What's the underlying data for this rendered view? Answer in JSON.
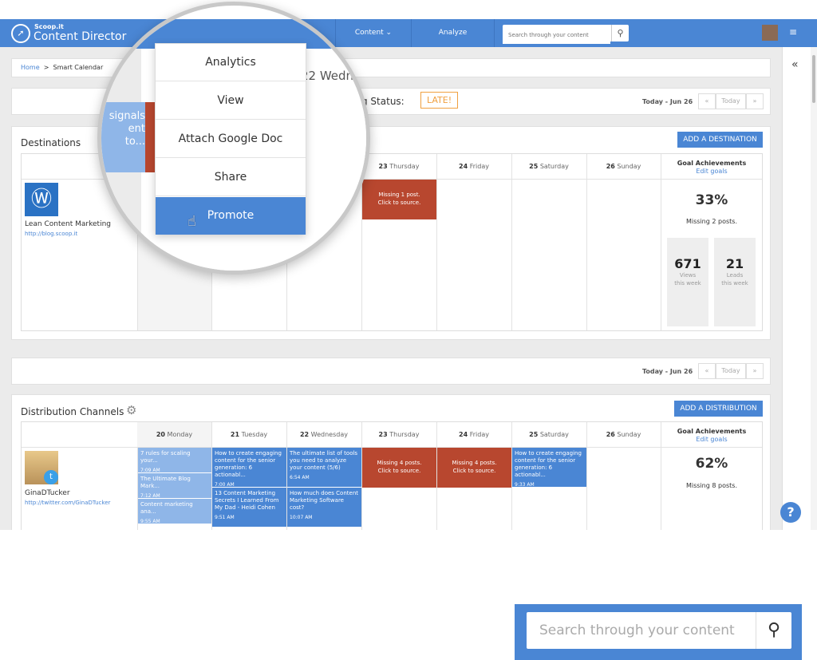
{
  "app": {
    "logo_small": "Scoop.it",
    "logo_title": "Content Director"
  },
  "nav": {
    "content": "Content",
    "analyze": "Analyze",
    "search_placeholder": "Search through your content"
  },
  "breadcrumb": {
    "home": "Home",
    "sep": ">",
    "current": "Smart Calendar"
  },
  "status": {
    "label": "g Status:",
    "value": "LATE!",
    "date_partial": "22 Wedn"
  },
  "pager": {
    "today_label": "Today - Jun 26",
    "prev": "«",
    "today": "Today",
    "next": "»"
  },
  "destinations": {
    "title": "Destinations",
    "add_button": "ADD A DESTINATION",
    "days": [
      {
        "num": "23",
        "name": "Thursday"
      },
      {
        "num": "24",
        "name": "Friday"
      },
      {
        "num": "25",
        "name": "Saturday"
      },
      {
        "num": "26",
        "name": "Sunday"
      }
    ],
    "goal_title": "Goal Achievements",
    "edit_goals": "Edit goals",
    "name": "Lean Content Marketing",
    "url": "http://blog.scoop.it",
    "missing_cell": [
      "Missing 1 post.",
      "Click to source."
    ],
    "percent": "33%",
    "missing": "Missing 2 posts.",
    "views": "671",
    "views_label": [
      "Views",
      "this week"
    ],
    "leads": "21",
    "leads_label": [
      "Leads",
      "this week"
    ]
  },
  "magnifier": {
    "menu": [
      "Analytics",
      "View",
      "Attach Google Doc",
      "Share",
      "Promote"
    ],
    "card_text": [
      "signals",
      "ent",
      "to..."
    ]
  },
  "channels": {
    "title": "Distribution Channels",
    "add_button": "ADD A DISTRIBUTION",
    "days": [
      {
        "num": "20",
        "name": "Monday"
      },
      {
        "num": "21",
        "name": "Tuesday"
      },
      {
        "num": "22",
        "name": "Wednesday"
      },
      {
        "num": "23",
        "name": "Thursday"
      },
      {
        "num": "24",
        "name": "Friday"
      },
      {
        "num": "25",
        "name": "Saturday"
      },
      {
        "num": "26",
        "name": "Sunday"
      }
    ],
    "goal_title": "Goal Achievements",
    "edit_goals": "Edit goals",
    "name": "GinaDTucker",
    "url": "http://twitter.com/GinaDTucker",
    "percent": "62%",
    "missing": "Missing 8 posts.",
    "monday": [
      {
        "title": "7 rules for scaling your...",
        "time": "7:09 AM"
      },
      {
        "title": "The Ultimate Blog Mark...",
        "time": "7:12 AM"
      },
      {
        "title": "Content marketing ana...",
        "time": "9:55 AM"
      }
    ],
    "tuesday": [
      {
        "title": "How to create engaging content for the senior generation: 6 actionabl...",
        "time": "7:00 AM"
      },
      {
        "title": "13 Content Marketing Secrets I Learned From My Dad - Heidi Cohen",
        "time": "9:51 AM"
      }
    ],
    "wednesday": [
      {
        "title": "The ultimate list of tools you need to analyze your content (5/6)",
        "time": "6:54 AM"
      },
      {
        "title": "How much does Content Marketing Software cost?",
        "time": "10:07 AM"
      }
    ],
    "thursday_missing": [
      "Missing 4 posts.",
      "Click to source."
    ],
    "friday_missing": [
      "Missing 4 posts.",
      "Click to source."
    ],
    "saturday": [
      {
        "title": "How to create engaging content for the senior generation: 6 actionabl...",
        "time": "9:33 AM"
      }
    ]
  },
  "help": "?",
  "colors": {
    "brand": "#4a86d4",
    "missing": "#b8472f",
    "late": "#f0a040"
  }
}
